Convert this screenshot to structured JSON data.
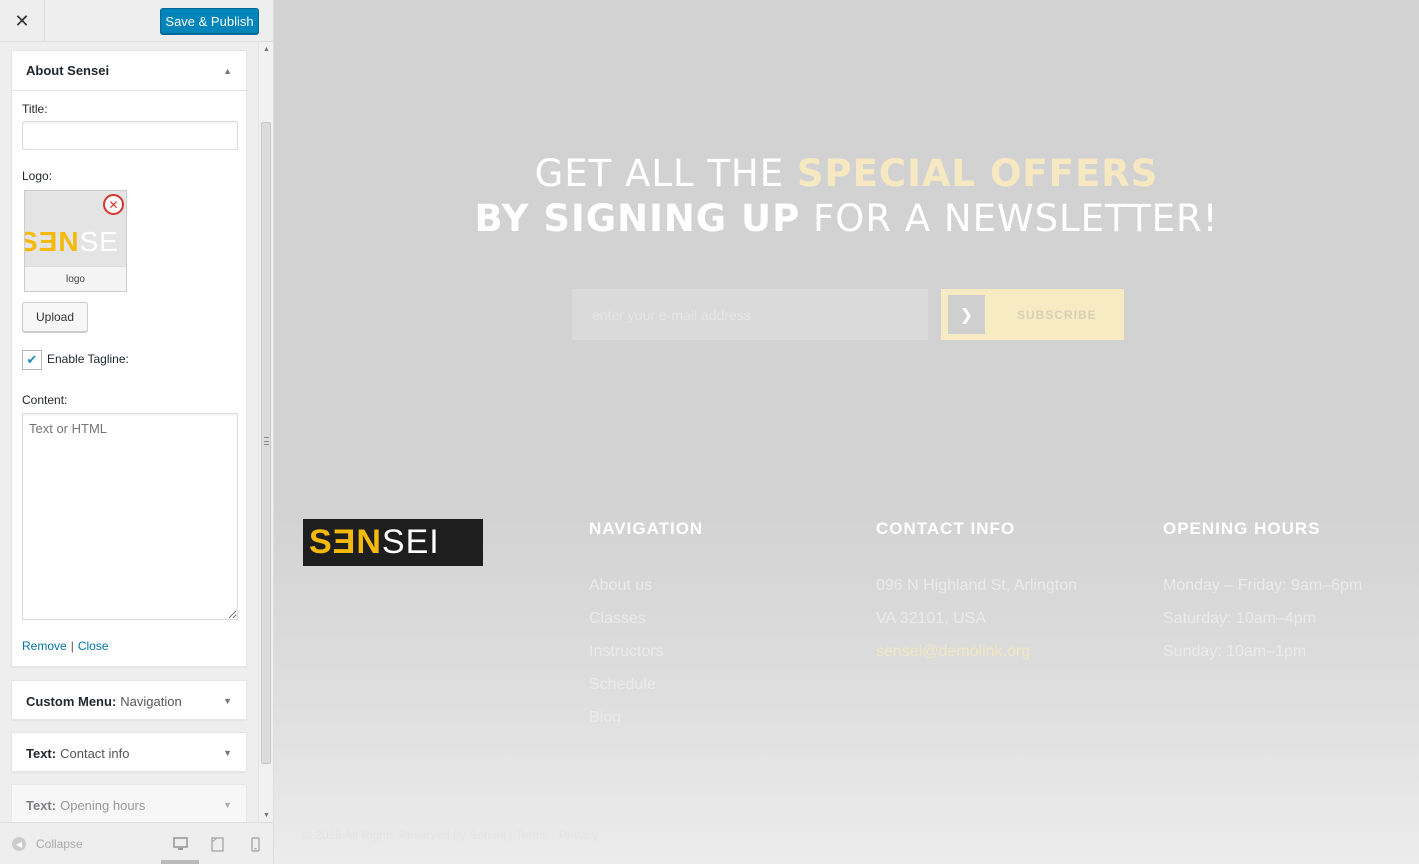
{
  "topbar": {
    "close_glyph": "✕",
    "publish_label": "Save & Publish"
  },
  "widgets": {
    "about": {
      "title": "About Sensei",
      "title_label": "Title:",
      "title_value": "",
      "logo_label": "Logo:",
      "logo_caption": "logo",
      "logo_text_yellow": "SƎN",
      "logo_text_white": "SE",
      "upload_label": "Upload",
      "tagline_label": "Enable Tagline:",
      "tagline_checked": true,
      "content_label": "Content:",
      "content_placeholder": "Text or HTML",
      "remove_label": "Remove",
      "separator": "|",
      "close_label": "Close"
    },
    "collapsed": [
      {
        "type": "Custom Menu:",
        "name": "Navigation"
      },
      {
        "type": "Text:",
        "name": "Contact info"
      },
      {
        "type": "Text:",
        "name": "Opening hours"
      }
    ]
  },
  "sidebar_footer": {
    "collapse_label": "Collapse"
  },
  "preview": {
    "headline_line1_plain": "GET ALL THE ",
    "headline_line1_highlight": "SPECIAL OFFERS",
    "headline_line2_bold": "BY SIGNING UP",
    "headline_line2_plain": " FOR A NEWSLETTER!",
    "email_placeholder": "enter your e-mail address",
    "subscribe_label": "SUBSCRIBE",
    "footer_logo_yellow": "SƎN",
    "footer_logo_white": "SEI",
    "navigation": {
      "heading": "NAVIGATION",
      "items": [
        "About us",
        "Classes",
        "Instructors",
        "Schedule",
        "Blog"
      ]
    },
    "contact": {
      "heading": "CONTACT INFO",
      "lines": [
        "096 N Highland St, Arlington",
        "VA 32101, USA",
        "sensei@demolink.org"
      ]
    },
    "hours": {
      "heading": "OPENING HOURS",
      "lines": [
        "Monday – Friday: 9am–6pm",
        "Saturday: 10am–4pm",
        "Sunday: 10am–1pm"
      ]
    },
    "copyright": "© 2016 All Rights Reserved by Sensei  |  Terms  ·  Privacy"
  },
  "colors": {
    "accent": "#0085ba",
    "brand_yellow": "#f5b90a",
    "highlight": "#f6e9c2",
    "danger": "#d9342b"
  }
}
